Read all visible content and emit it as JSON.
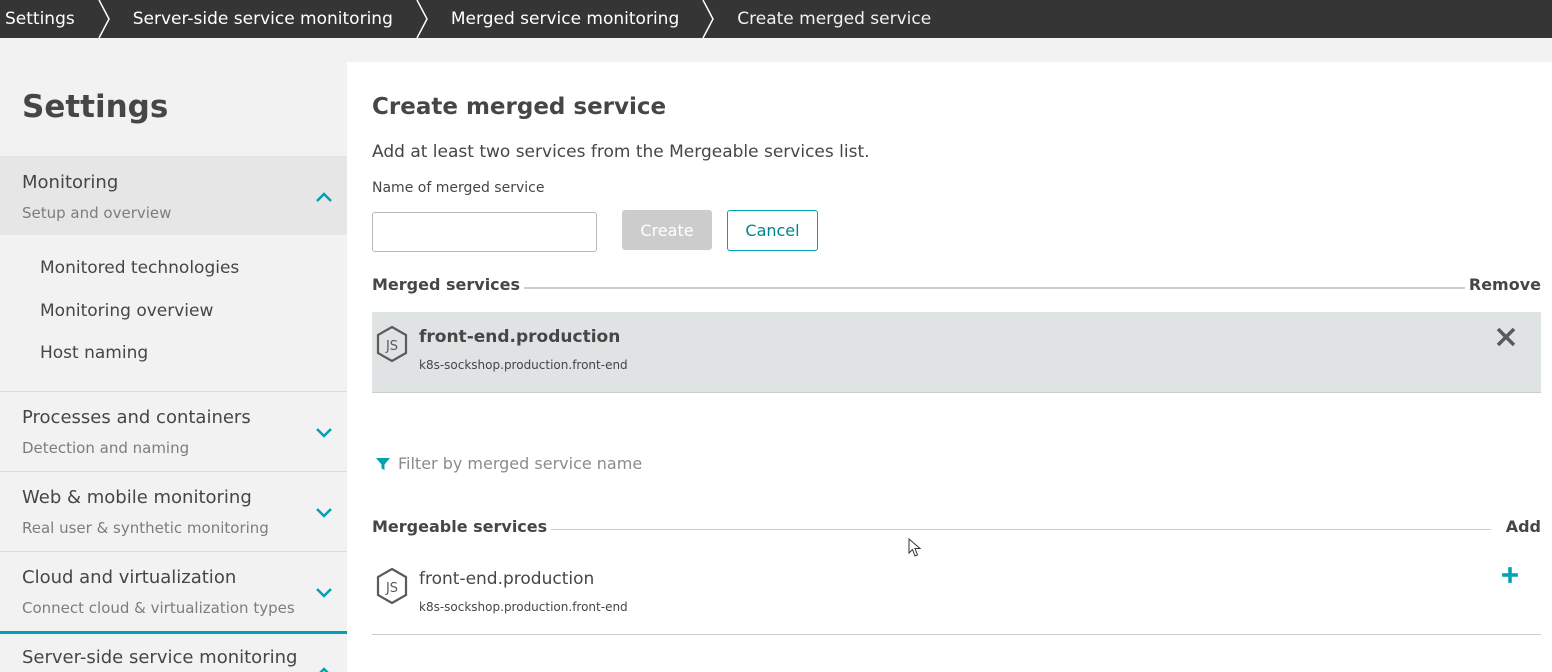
{
  "breadcrumb": [
    {
      "label": "Settings"
    },
    {
      "label": "Server-side service monitoring"
    },
    {
      "label": "Merged service monitoring"
    },
    {
      "label": "Create merged service"
    }
  ],
  "sidebar": {
    "title": "Settings",
    "groups": [
      {
        "title": "Monitoring",
        "subtitle": "Setup and overview",
        "expanded": true,
        "items": [
          "Monitored technologies",
          "Monitoring overview",
          "Host naming"
        ]
      },
      {
        "title": "Processes and containers",
        "subtitle": "Detection and naming",
        "expanded": false
      },
      {
        "title": "Web & mobile monitoring",
        "subtitle": "Real user & synthetic monitoring",
        "expanded": false
      },
      {
        "title": "Cloud and virtualization",
        "subtitle": "Connect cloud & virtualization types",
        "expanded": false
      },
      {
        "title": "Server-side service monitoring",
        "expanded": true
      }
    ]
  },
  "main": {
    "title": "Create merged service",
    "description": "Add at least two services from the Mergeable services list.",
    "name_field": {
      "label": "Name of merged service",
      "value": "",
      "placeholder": ""
    },
    "create_label": "Create",
    "cancel_label": "Cancel",
    "merged": {
      "title": "Merged services",
      "action_label": "Remove",
      "services": [
        {
          "name": "front-end.production",
          "id": "k8s-sockshop.production.front-end",
          "icon": "nodejs-icon"
        }
      ]
    },
    "filter_placeholder": "Filter by merged service name",
    "mergeable": {
      "title": "Mergeable services",
      "action_label": "Add",
      "services": [
        {
          "name": "front-end.production",
          "id": "k8s-sockshop.production.front-end",
          "icon": "nodejs-icon"
        }
      ]
    }
  },
  "colors": {
    "accent": "#00a1b2",
    "breadcrumb_bg": "#353535",
    "sidebar_bg": "#f2f2f2",
    "selected_row_bg": "#dfe3e3"
  }
}
